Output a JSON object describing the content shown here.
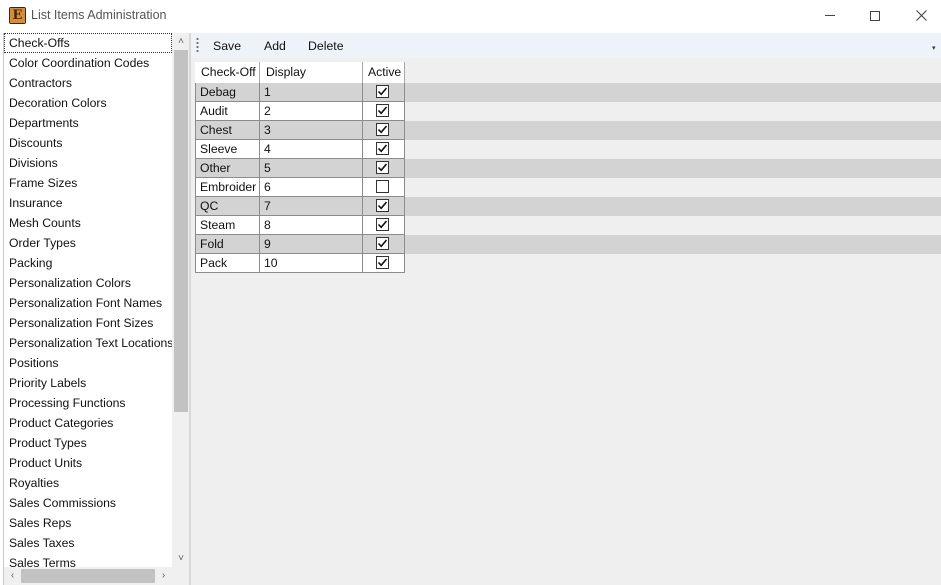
{
  "window": {
    "title": "List Items Administration",
    "app_icon_letter": "E",
    "minimize": "minimize",
    "maximize": "maximize",
    "close": "close"
  },
  "sidebar": {
    "items": [
      {
        "label": "Check-Offs",
        "selected": true
      },
      {
        "label": "Color Coordination Codes"
      },
      {
        "label": "Contractors"
      },
      {
        "label": "Decoration Colors"
      },
      {
        "label": "Departments"
      },
      {
        "label": "Discounts"
      },
      {
        "label": "Divisions"
      },
      {
        "label": "Frame Sizes"
      },
      {
        "label": "Insurance"
      },
      {
        "label": "Mesh Counts"
      },
      {
        "label": "Order Types"
      },
      {
        "label": "Packing"
      },
      {
        "label": "Personalization Colors"
      },
      {
        "label": "Personalization Font Names"
      },
      {
        "label": "Personalization Font Sizes"
      },
      {
        "label": "Personalization Text Locations"
      },
      {
        "label": "Positions"
      },
      {
        "label": "Priority Labels"
      },
      {
        "label": "Processing Functions"
      },
      {
        "label": "Product Categories"
      },
      {
        "label": "Product Types"
      },
      {
        "label": "Product Units"
      },
      {
        "label": "Royalties"
      },
      {
        "label": "Sales Commissions"
      },
      {
        "label": "Sales Reps"
      },
      {
        "label": "Sales Taxes"
      },
      {
        "label": "Sales Terms"
      }
    ]
  },
  "toolbar": {
    "save_label": "Save",
    "add_label": "Add",
    "delete_label": "Delete"
  },
  "grid": {
    "columns": [
      "Check-Off",
      "Display Sequence",
      "Active"
    ],
    "rows": [
      {
        "check_off": "Debag",
        "sequence": "1",
        "active": true
      },
      {
        "check_off": "Audit",
        "sequence": "2",
        "active": true
      },
      {
        "check_off": "Chest",
        "sequence": "3",
        "active": true
      },
      {
        "check_off": "Sleeve",
        "sequence": "4",
        "active": true
      },
      {
        "check_off": "Other",
        "sequence": "5",
        "active": true
      },
      {
        "check_off": "Embroider",
        "sequence": "6",
        "active": false
      },
      {
        "check_off": "QC",
        "sequence": "7",
        "active": true
      },
      {
        "check_off": "Steam",
        "sequence": "8",
        "active": true
      },
      {
        "check_off": "Fold",
        "sequence": "9",
        "active": true
      },
      {
        "check_off": "Pack",
        "sequence": "10",
        "active": true
      }
    ]
  },
  "colors": {
    "alt_row": "#d3d3d3",
    "toolbar_bg": "#eef3fa",
    "panel_bg": "#efefef"
  }
}
